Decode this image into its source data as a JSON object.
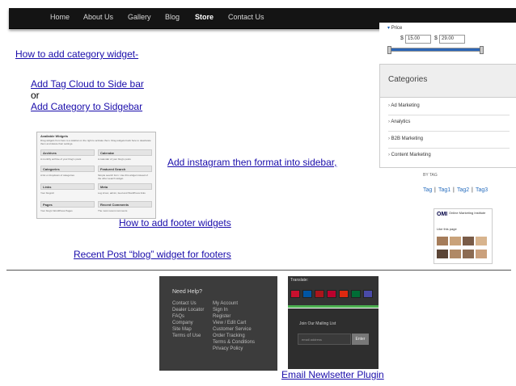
{
  "nav": {
    "items": [
      {
        "label": "Home"
      },
      {
        "label": "About Us"
      },
      {
        "label": "Gallery"
      },
      {
        "label": "Blog"
      },
      {
        "label": "Store"
      },
      {
        "label": "Contact Us"
      }
    ],
    "active": "Store"
  },
  "notes": {
    "category_widget": "How to add category widget-",
    "tag_cloud": "Add Tag Cloud to Side bar",
    "or": "or",
    "category_sidebar": "Add Category to Sidgebar",
    "instagram": "Add instagram then format into sidebar,",
    "footer_widgets": "How to add footer widgets",
    "recent_post": "Recent Post “blog” widget for footers",
    "newsletter": "Email Newlsetter Plugin"
  },
  "price_filter": {
    "title": "Price",
    "currency": "$",
    "min": "15.00",
    "max": "29.00"
  },
  "categories": {
    "title": "Categories",
    "items": [
      "Ad Marketing",
      "Analytics",
      "B2B Marketing",
      "Content Marketing"
    ]
  },
  "tags": {
    "title": "BY TAG",
    "items": [
      "Tag",
      "Tag1",
      "Tag2",
      "Tag3"
    ]
  },
  "social": {
    "logo": "OMI",
    "name": "Online Marketing Institute",
    "note": "Like this page"
  },
  "widgets_panel": {
    "title": "Available Widgets",
    "desc": "Drag widgets from here to a sidebar on the right to activate them. Drag widgets back here to deactivate them and delete their settings.",
    "items": [
      {
        "name": "Archives",
        "desc": "A monthly archive of your blog's posts"
      },
      {
        "name": "Calendar",
        "desc": "A calendar of your blog's posts"
      },
      {
        "name": "Categories",
        "desc": "A list or dropdown of categories"
      },
      {
        "name": "Featured Search",
        "desc": "Simple search form. Use this widget instead of the other search widget."
      },
      {
        "name": "Links",
        "desc": "Your blogroll"
      },
      {
        "name": "Meta",
        "desc": "Log in/out, admin, feed and WordPress links"
      },
      {
        "name": "Pages",
        "desc": "Your blog's WordPress Pages"
      },
      {
        "name": "Recent Comments",
        "desc": "The most recent comments"
      }
    ]
  },
  "footer": {
    "heading": "Need Help?",
    "col1": [
      "Contact Us",
      "Dealer Locator",
      "FAQs",
      "Company",
      "Site Map",
      "Terms of Use"
    ],
    "col2": [
      "My Account",
      "Sign In",
      "Register",
      "View / Edit Cart",
      "Customer Service",
      "Order Tracking",
      "Terms & Conditions",
      "Privacy Policy"
    ]
  },
  "translate": {
    "title": "Translate:",
    "flags": [
      "#c8102e",
      "#0055a4",
      "#aa151b",
      "#bc002d",
      "#de2910",
      "#006c35",
      "#4a4aa8"
    ]
  },
  "newsletter_box": {
    "heading": "Join Our Mailing List",
    "placeholder": "email address",
    "button": "Enter"
  }
}
